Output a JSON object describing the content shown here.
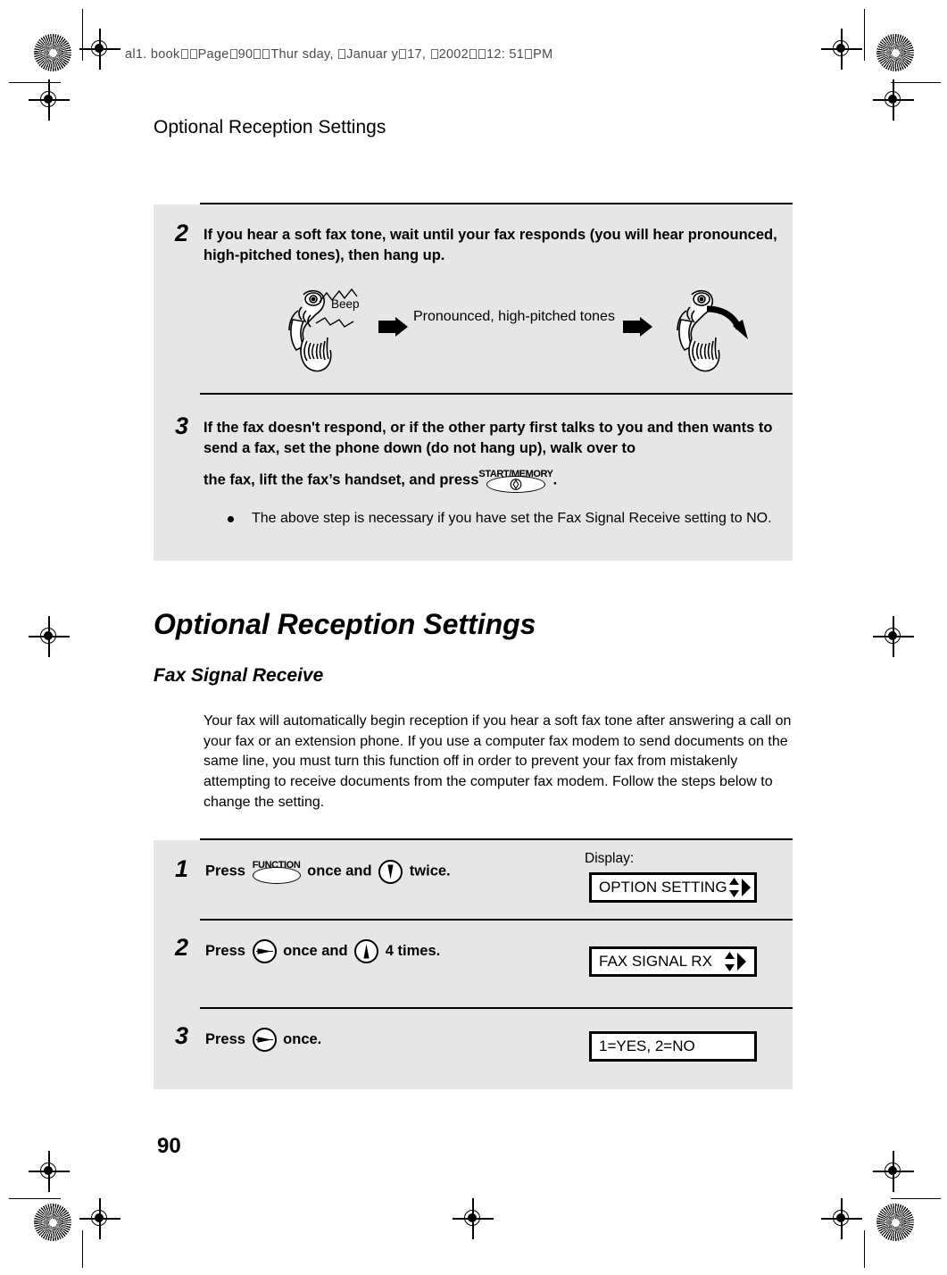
{
  "print_marks": {
    "file_header": "al1.book  Page 90  Thursday, January 17, 2002  12:51 PM",
    "file_header_parts": [
      "al",
      "1",
      ". book",
      "Page",
      "90",
      "Thur sday, ",
      "J",
      "anuar y",
      "17, ",
      "2002",
      "12: 51",
      "PM"
    ]
  },
  "running_head": "Optional Reception Settings",
  "page_number": "90",
  "top_panel": {
    "steps": [
      {
        "number": "2",
        "text": "If you hear a soft fax tone, wait until your fax responds (you will hear pronounced, high-pitched tones), then hang up."
      },
      {
        "number": "3",
        "text_part1": "If the fax doesn't respond, or if the other party first talks to you and then wants to send a fax, set the phone down (do not hang up), walk over to",
        "text_part2": "the fax, lift the fax’s handset, and press",
        "button_label": "START/MEMORY",
        "text_part3": "."
      }
    ],
    "illustration": {
      "beep_label": "Beep",
      "caption": "Pronounced, high-pitched tones"
    },
    "bullet": "The above step is necessary if you have set the Fax Signal Receive setting to NO."
  },
  "section": {
    "title": "Optional Reception Settings",
    "subtitle": "Fax Signal Receive",
    "paragraph": "Your fax will automatically begin reception if you hear a soft fax tone after answering a call on your fax or an extension phone. If you use a computer fax modem to send documents on the same line, you must turn this function off in order to prevent your fax from mistakenly attempting to receive documents from the computer fax modem. Follow the steps below to change the setting."
  },
  "procedure": {
    "display_label": "Display:",
    "steps": [
      {
        "number": "1",
        "press_label": "Press",
        "key1_label": "FUNCTION",
        "key1_icon": "function-key",
        "mid_text": "once and",
        "key2_icon": "down-arrow-key",
        "end_text": "twice.",
        "display_text": "OPTION SETTING",
        "display_arrows": "updown-right"
      },
      {
        "number": "2",
        "press_label": "Press",
        "key1_icon": "right-arrow-key",
        "mid_text": "once and",
        "key2_icon": "up-arrow-key",
        "end_text": "4 times.",
        "display_text": "FAX SIGNAL RX",
        "display_arrows": "updown-right"
      },
      {
        "number": "3",
        "press_label": "Press",
        "key1_icon": "right-arrow-key",
        "end_text": "once.",
        "display_text": "1=YES, 2=NO",
        "display_arrows": "none"
      }
    ]
  },
  "colors": {
    "panel_background": "#e6e6e6",
    "page_background": "#ffffff",
    "ink": "#000000",
    "header_gray": "#4b4b4b"
  }
}
